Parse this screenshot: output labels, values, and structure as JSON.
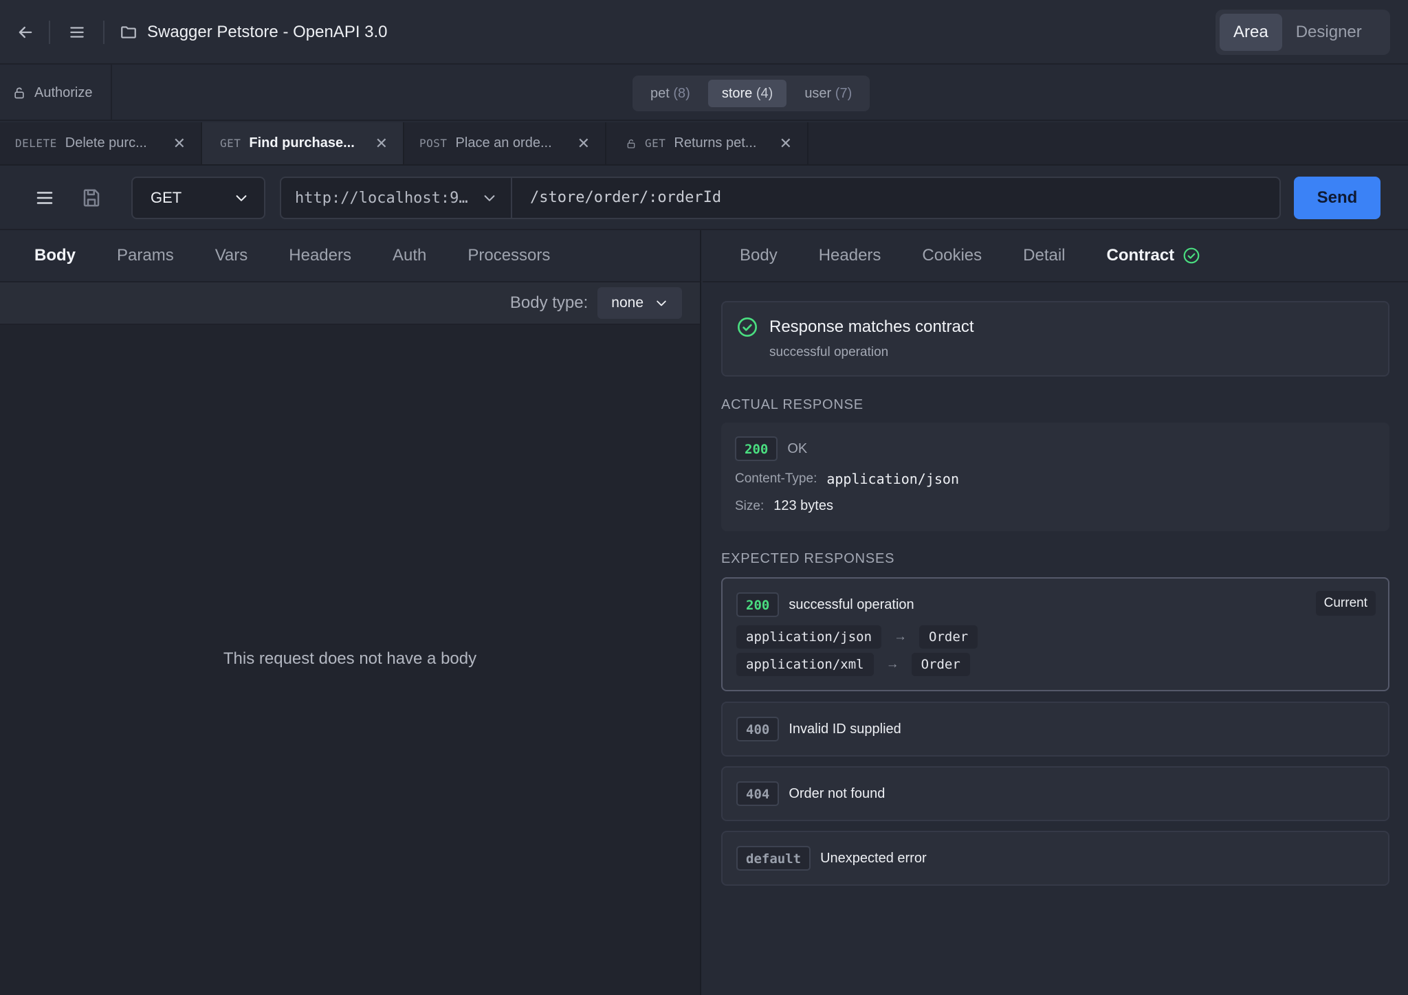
{
  "topbar": {
    "title": "Swagger Petstore - OpenAPI 3.0",
    "modes": [
      {
        "label": "Area",
        "active": true
      },
      {
        "label": "Designer",
        "active": false
      }
    ]
  },
  "subbar": {
    "authorize_label": "Authorize",
    "tags": [
      {
        "name": "pet",
        "count": "(8)",
        "active": false
      },
      {
        "name": "store",
        "count": "(4)",
        "active": true
      },
      {
        "name": "user",
        "count": "(7)",
        "active": false
      }
    ]
  },
  "request_tabs": [
    {
      "method": "DELETE",
      "title": "Delete purc...",
      "active": false,
      "locked": false
    },
    {
      "method": "GET",
      "title": "Find purchase...",
      "active": true,
      "locked": false
    },
    {
      "method": "POST",
      "title": "Place an orde...",
      "active": false,
      "locked": false
    },
    {
      "method": "GET",
      "title": "Returns pet...",
      "active": false,
      "locked": true
    }
  ],
  "urlbar": {
    "method": "GET",
    "server": "http://localhost:9…",
    "path": "/store/order/:orderId",
    "send_label": "Send"
  },
  "request_pane": {
    "tabs": [
      "Body",
      "Params",
      "Vars",
      "Headers",
      "Auth",
      "Processors"
    ],
    "active_tab": "Body",
    "body_type_label": "Body type:",
    "body_type_value": "none",
    "empty_message": "This request does not have a body"
  },
  "response_pane": {
    "tabs": [
      "Body",
      "Headers",
      "Cookies",
      "Detail",
      "Contract"
    ],
    "active_tab": "Contract",
    "match": {
      "title": "Response matches contract",
      "subtitle": "successful operation"
    },
    "actual_heading": "ACTUAL RESPONSE",
    "actual": {
      "status_code": "200",
      "status_text": "OK",
      "content_type_label": "Content-Type:",
      "content_type": "application/json",
      "size_label": "Size:",
      "size": "123 bytes"
    },
    "expected_heading": "EXPECTED RESPONSES",
    "expected": [
      {
        "code": "200",
        "description": "successful operation",
        "current_label": "Current",
        "media": [
          {
            "type": "application/json",
            "arrow": "→",
            "schema": "Order"
          },
          {
            "type": "application/xml",
            "arrow": "→",
            "schema": "Order"
          }
        ]
      },
      {
        "code": "400",
        "description": "Invalid ID supplied"
      },
      {
        "code": "404",
        "description": "Order not found"
      },
      {
        "code": "default",
        "description": "Unexpected error"
      }
    ]
  },
  "colors": {
    "accent": "#3b82f6",
    "success": "#4ade80",
    "background": "#262a35"
  }
}
